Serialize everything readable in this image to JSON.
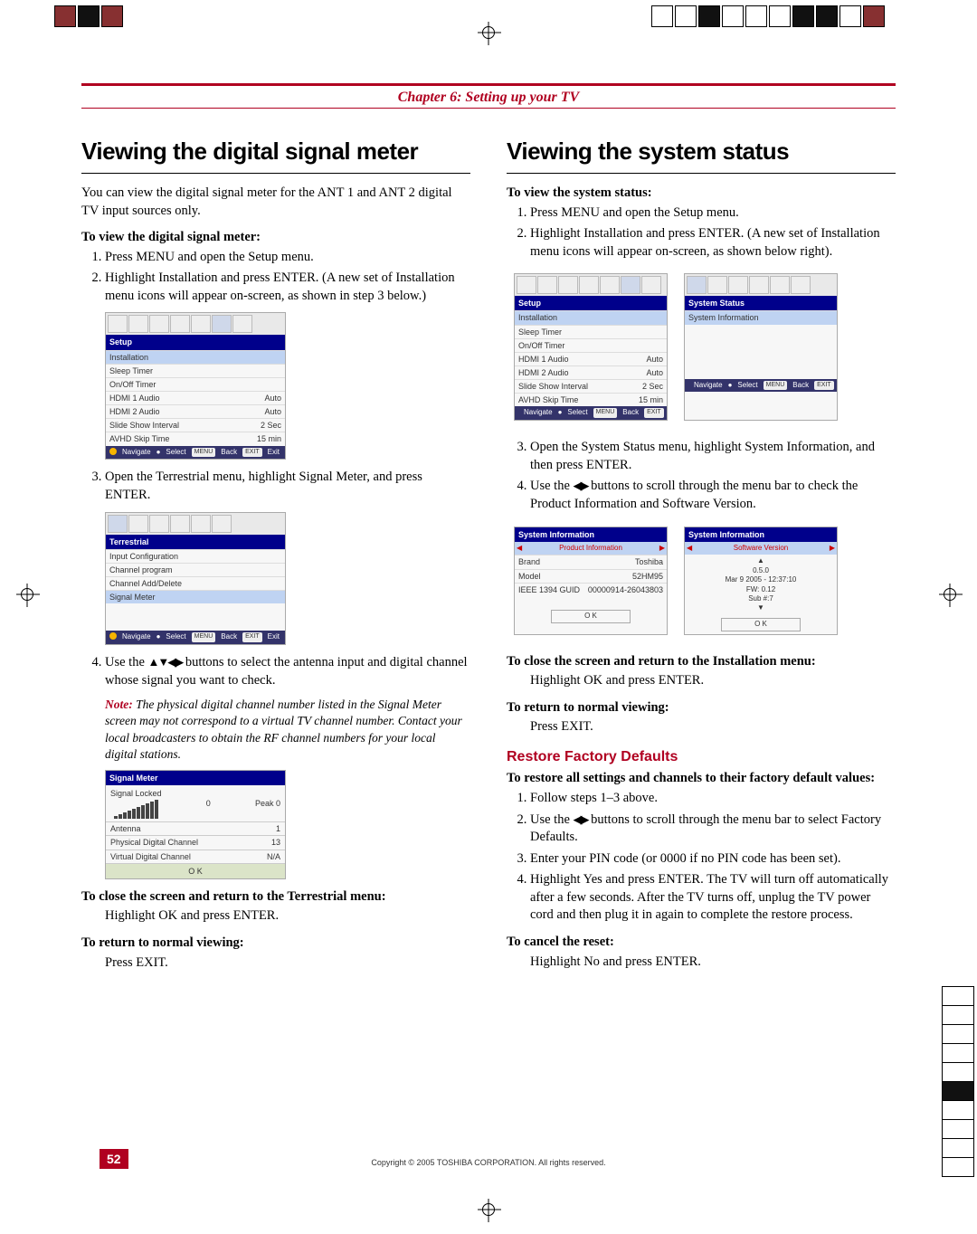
{
  "chapter": {
    "label": "Chapter 6: Setting up your TV"
  },
  "left": {
    "title": "Viewing the digital signal meter",
    "intro": "You can view the digital signal meter for the ANT 1 and ANT 2 digital TV input sources only.",
    "h1": "To view the digital signal meter:",
    "s1": "Press MENU and open the Setup menu.",
    "s2": "Highlight Installation and press ENTER. (A new set of Installation menu icons will appear on-screen, as shown in step 3 below.)",
    "s3": "Open the Terrestrial menu, highlight Signal Meter, and press ENTER.",
    "s4_pre": "Use the ",
    "s4_arrows": "▲▼◀▶",
    "s4_post": " buttons to select the antenna input and digital channel whose signal you want to check.",
    "note_lead": "Note:",
    "note_body": " The physical digital channel number listed in the Signal Meter screen may not correspond to a virtual TV channel number. Contact your local broadcasters to obtain the RF channel numbers for your local digital stations.",
    "closeh": "To close the screen and return to the Terrestrial menu:",
    "close_body": "Highlight OK and press ENTER.",
    "returnh": "To return to normal viewing:",
    "return_body": "Press EXIT.",
    "osd_setup": {
      "header": "Setup",
      "rows": [
        {
          "l": "Installation",
          "r": "",
          "sel": true
        },
        {
          "l": "Sleep Timer",
          "r": ""
        },
        {
          "l": "On/Off Timer",
          "r": ""
        },
        {
          "l": "HDMI 1 Audio",
          "r": "Auto"
        },
        {
          "l": "HDMI 2 Audio",
          "r": "Auto"
        },
        {
          "l": "Slide Show Interval",
          "r": "2 Sec"
        },
        {
          "l": "AVHD Skip Time",
          "r": "15 min"
        }
      ],
      "nav": [
        "Navigate",
        "Select",
        "Back",
        "Exit"
      ]
    },
    "osd_terr": {
      "header": "Terrestrial",
      "rows": [
        {
          "l": "Input Configuration",
          "r": ""
        },
        {
          "l": "Channel program",
          "r": ""
        },
        {
          "l": "Channel Add/Delete",
          "r": ""
        },
        {
          "l": "Signal Meter",
          "r": "",
          "sel": true
        }
      ],
      "nav": [
        "Navigate",
        "Select",
        "Back",
        "Exit"
      ]
    },
    "osd_sig": {
      "header": "Signal Meter",
      "locked": "Signal Locked",
      "val": "0",
      "peak": "Peak",
      "peakv": "0",
      "rows": [
        {
          "l": "Antenna",
          "r": "1"
        },
        {
          "l": "Physical Digital Channel",
          "r": "13"
        },
        {
          "l": "Virtual Digital Channel",
          "r": "N/A"
        }
      ],
      "ok": "O K"
    }
  },
  "right": {
    "title": "Viewing the system status",
    "h1": "To view the system status:",
    "s1": "Press MENU and open the Setup menu.",
    "s2": "Highlight Installation and press ENTER. (A new set of Installation menu icons will appear on-screen, as shown below right).",
    "s3": "Open the System Status menu, highlight System Information, and then press ENTER.",
    "s4_pre": "Use the ",
    "s4_arrows": "◀▶",
    "s4_post": " buttons to scroll through the menu bar to check the Product Information and Software Version.",
    "osd_setup": {
      "header": "Setup",
      "rows": [
        {
          "l": "Installation",
          "r": "",
          "sel": true
        },
        {
          "l": "Sleep Timer",
          "r": ""
        },
        {
          "l": "On/Off Timer",
          "r": ""
        },
        {
          "l": "HDMI 1 Audio",
          "r": "Auto"
        },
        {
          "l": "HDMI 2 Audio",
          "r": "Auto"
        },
        {
          "l": "Slide Show Interval",
          "r": "2 Sec"
        },
        {
          "l": "AVHD Skip Time",
          "r": "15 min"
        }
      ],
      "nav": [
        "Navigate",
        "Select",
        "Back",
        "Exit"
      ]
    },
    "osd_status": {
      "header": "System Status",
      "rows": [
        {
          "l": "System Information",
          "r": "",
          "sel": true
        }
      ],
      "nav": [
        "Navigate",
        "Select",
        "Back",
        "Exit"
      ]
    },
    "osd_prod": {
      "header": "System Information",
      "sub": "Product Information",
      "rows": [
        {
          "l": "Brand",
          "r": "Toshiba"
        },
        {
          "l": "Model",
          "r": "52HM95"
        },
        {
          "l": "IEEE 1394 GUID",
          "r": "00000914-26043803"
        }
      ],
      "ok": "O K"
    },
    "osd_sw": {
      "header": "System Information",
      "sub": "Software Version",
      "lines": [
        "0.5.0",
        "Mar 9 2005 - 12:37:10",
        "FW: 0.12",
        "Sub #:7"
      ],
      "ok": "O K"
    },
    "closeh": "To close the screen and return to the Installation menu:",
    "close_body": "Highlight OK and press ENTER.",
    "returnh": "To return to normal viewing:",
    "return_body": "Press EXIT.",
    "restore_h": "Restore Factory Defaults",
    "restore_lead": "To restore all settings and channels to their factory default values:",
    "r1": "Follow steps 1–3 above.",
    "r2_pre": "Use the ",
    "r2_arrows": "◀▶",
    "r2_post": " buttons to scroll through the menu bar to select Factory Defaults.",
    "r3": "Enter your PIN code (or 0000 if no PIN code has been set).",
    "r4": "Highlight Yes and press ENTER. The TV will turn off automatically after a few seconds. After the TV turns off, unplug the TV power cord and then plug it in again to complete the restore process.",
    "cancelh": "To cancel the reset:",
    "cancel_body": "Highlight No and press ENTER."
  },
  "footer": {
    "page": "52",
    "copyright": "Copyright © 2005 TOSHIBA CORPORATION. All rights reserved."
  }
}
